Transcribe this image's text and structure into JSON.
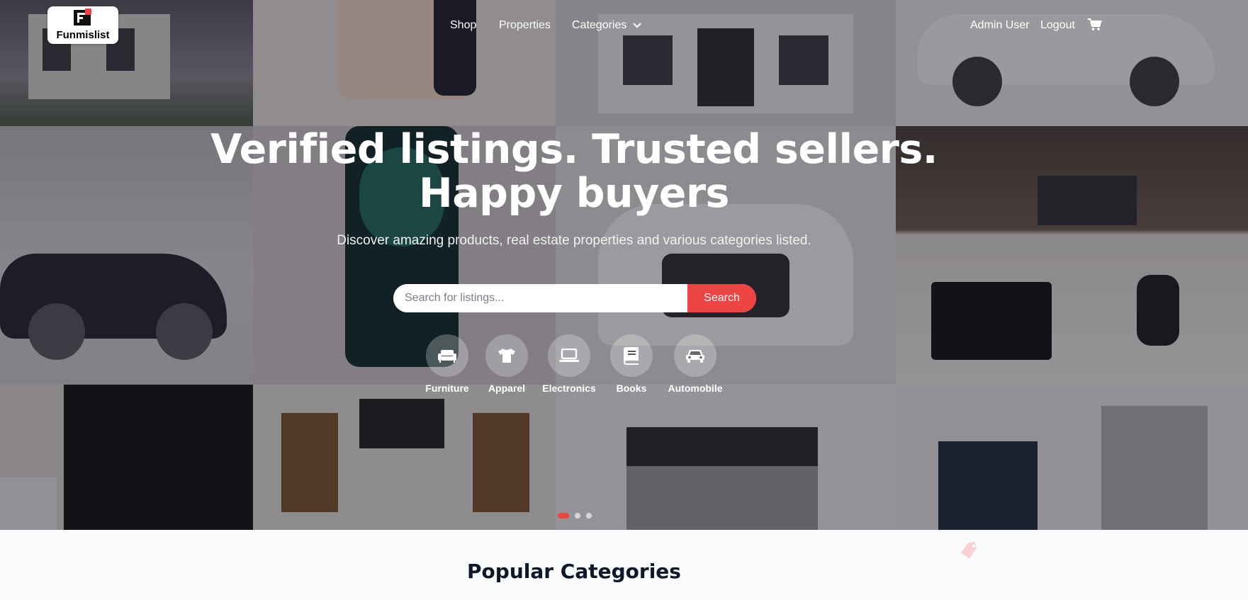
{
  "brand": {
    "name": "Funmislist"
  },
  "nav": {
    "links": [
      {
        "label": "Shop"
      },
      {
        "label": "Properties"
      },
      {
        "label": "Categories"
      }
    ],
    "user": "Admin User",
    "logout": "Logout"
  },
  "hero": {
    "headline_line1": "Verified listings. Trusted sellers.",
    "headline_line2": "Happy buyers",
    "subtitle": "Discover amazing products, real estate properties and various categories listed.",
    "search": {
      "placeholder": "Search for listings...",
      "button": "Search"
    },
    "categories": [
      {
        "label": "Furniture",
        "icon": "sofa-icon"
      },
      {
        "label": "Apparel",
        "icon": "tshirt-icon"
      },
      {
        "label": "Electronics",
        "icon": "laptop-icon"
      },
      {
        "label": "Books",
        "icon": "book-icon"
      },
      {
        "label": "Automobile",
        "icon": "car-icon"
      }
    ],
    "carousel": {
      "slides": 3,
      "active": 1
    }
  },
  "sections": {
    "popular_title": "Popular Categories"
  },
  "colors": {
    "accent": "#ef4444",
    "heading": "#0f172a",
    "page_bg": "#f8fafc"
  }
}
